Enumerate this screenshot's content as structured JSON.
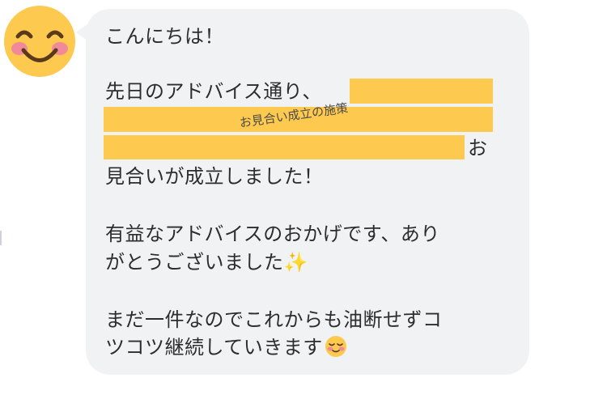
{
  "message": {
    "greeting": "こんにちは！",
    "line1": "先日のアドバイス通り、",
    "redacted_label": "お見合い成立の施策",
    "line3_tail": "お",
    "line4": "見合いが成立しました！",
    "line5": "有益なアドバイスのおかげです、あり",
    "line6": "がとうございました",
    "line6_emoji": "✨",
    "line7": "まだ一件なのでこれからも油断せずコ",
    "line8": "ツコツ継続していきます",
    "line8_emoji": "😌"
  },
  "avatar": {
    "icon": "smiling-face-with-blush-icon"
  },
  "colors": {
    "bubble": "#f1f2f4",
    "highlight": "#fdc94f",
    "avatar_face": "#fdc94f",
    "blush": "#f08a9b"
  }
}
